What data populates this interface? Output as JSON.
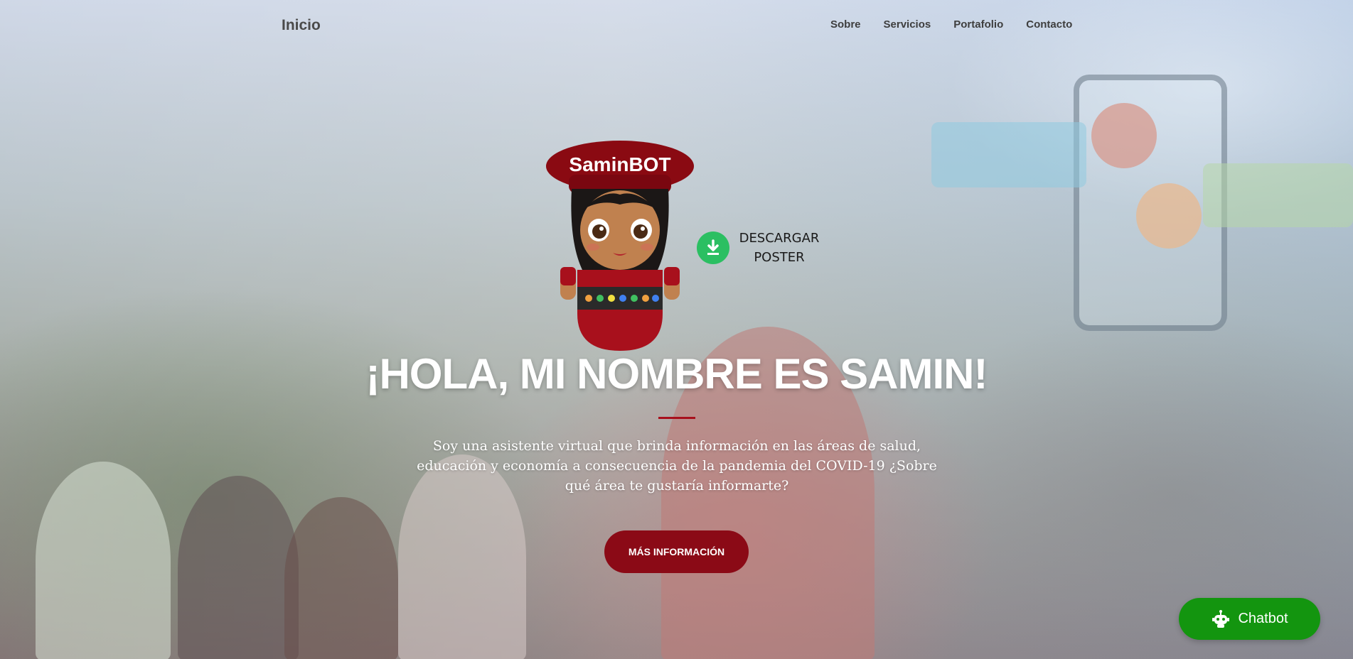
{
  "nav": {
    "brand": "Inicio",
    "links": [
      "Sobre",
      "Servicios",
      "Portafolio",
      "Contacto"
    ]
  },
  "mascot": {
    "hat_text": "SaminBOT",
    "icon": "mascot-illustration"
  },
  "download": {
    "line1": "DESCARGAR",
    "line2": "POSTER",
    "icon": "download-icon"
  },
  "hero": {
    "headline": "¡HOLA, MI NOMBRE ES SAMIN!",
    "subtitle": "Soy una asistente virtual que brinda información en las áreas de salud, educación y economía a consecuencia de la pandemia del COVID-19 ¿Sobre qué área te gustaría informarte?",
    "cta_label": "MÁS INFORMACIÓN"
  },
  "chatbot": {
    "label": "Chatbot",
    "icon": "robot-icon"
  },
  "colors": {
    "accent": "#8b0a16",
    "download_green": "#2bbf62",
    "chatbot_green": "#13950f",
    "nav_text": "#3e3e3e"
  }
}
